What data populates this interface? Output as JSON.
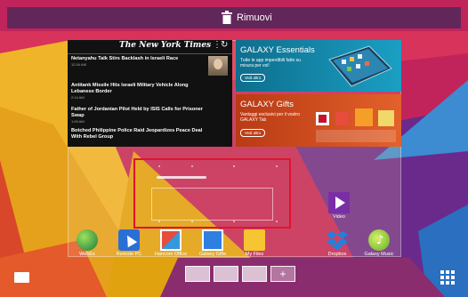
{
  "remove_bar": {
    "label": "Rimuovi"
  },
  "nyt_widget": {
    "logo": "The New York Times",
    "news": [
      {
        "title": "Netanyahu Talk Stirs Backlash in Israeli Race",
        "time": "12:34 AM"
      },
      {
        "title": "Antitank Missile Hits Israeli Military Vehicle Along Lebanese Border",
        "time": "2:14 AM"
      },
      {
        "title": "Father of Jordanian Pilot Held by ISIS Calls for Prisoner Swap",
        "time": "1:09 AM"
      },
      {
        "title": "Botched Philippine Police Raid Jeopardizes Peace Deal With Rebel Group",
        "time": ""
      }
    ]
  },
  "essentials": {
    "title": "GALAXY Essentials",
    "subtitle": "Tutte le app imperdibili fatte su misura per voi!",
    "button": "Vedi altro"
  },
  "gifts": {
    "title": "GALAXY Gifts",
    "subtitle": "Vantaggi esclusivi per il vostro GALAXY Tab",
    "button": "Vedi altro"
  },
  "video": {
    "label": "Video"
  },
  "dock": [
    {
      "label": "WebEx",
      "icon": "webex-icon"
    },
    {
      "label": "Remote PC",
      "icon": "remote-pc-icon"
    },
    {
      "label": "Hancom Office",
      "icon": "hancom-office-icon"
    },
    {
      "label": "Galaxy Gifts",
      "icon": "galaxy-gifts-icon"
    },
    {
      "label": "My Files",
      "icon": "folder-icon"
    },
    {
      "label": "Dropbox",
      "icon": "dropbox-icon"
    },
    {
      "label": "Galaxy Music",
      "icon": "music-icon"
    }
  ],
  "colors": {
    "selection": "#e0142c",
    "remove_bar": "#50285a"
  }
}
